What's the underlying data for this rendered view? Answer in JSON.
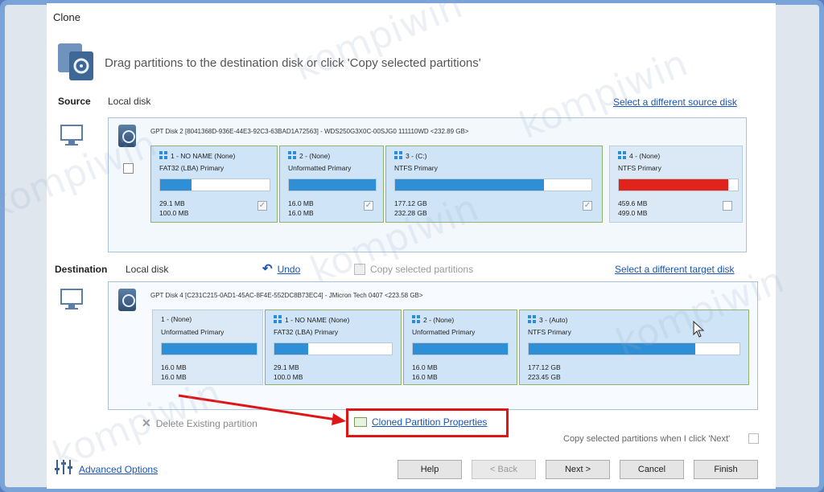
{
  "window": {
    "title": "Clone"
  },
  "hero": {
    "text": "Drag partitions to the destination disk or click 'Copy selected partitions'"
  },
  "source": {
    "label": "Source",
    "disk_label": "Local disk",
    "link": "Select a different source disk",
    "disk_header": "GPT Disk 2 [8041368D-936E-44E3-92C3-63BAD1A72563] - WDS250G3X0C-00SJG0 111110WD  <232.89 GB>",
    "partitions": [
      {
        "name": "1 - NO NAME (None)",
        "fs": "FAT32 (LBA) Primary",
        "used": "29.1 MB",
        "size": "100.0 MB",
        "fill": 0.29,
        "checked": true,
        "win": true
      },
      {
        "name": "2 - (None)",
        "fs": "Unformatted Primary",
        "used": "16.0 MB",
        "size": "16.0 MB",
        "fill": 1.0,
        "checked": true,
        "win": true
      },
      {
        "name": "3 - (C:)",
        "fs": "NTFS Primary",
        "used": "177.12 GB",
        "size": "232.28 GB",
        "fill": 0.76,
        "checked": true,
        "win": true
      },
      {
        "name": "4 - (None)",
        "fs": "NTFS Primary",
        "used": "459.6 MB",
        "size": "499.0 MB",
        "fill": 0.92,
        "checked": false,
        "win": true
      }
    ]
  },
  "destination": {
    "label": "Destination",
    "disk_label": "Local disk",
    "undo": "Undo",
    "copy_selected": "Copy selected partitions",
    "link": "Select a different target disk",
    "disk_header": "GPT Disk 4 [C231C215-0AD1-45AC-8F4E-552DC8B73EC4] - JMicron  Tech            0407  <223.58 GB>",
    "partitions": [
      {
        "name": "1 - (None)",
        "fs": "Unformatted Primary",
        "used": "16.0 MB",
        "size": "16.0 MB",
        "fill": 1.0,
        "win": false
      },
      {
        "name": "1 - NO NAME (None)",
        "fs": "FAT32 (LBA) Primary",
        "used": "29.1 MB",
        "size": "100.0 MB",
        "fill": 0.29,
        "win": true
      },
      {
        "name": "2 - (None)",
        "fs": "Unformatted Primary",
        "used": "16.0 MB",
        "size": "16.0 MB",
        "fill": 1.0,
        "win": true
      },
      {
        "name": "3 - (Auto)",
        "fs": "NTFS Primary",
        "used": "177.12 GB",
        "size": "223.45 GB",
        "fill": 0.79,
        "win": true
      }
    ]
  },
  "actions": {
    "delete_existing": "Delete Existing partition",
    "cloned_props": "Cloned Partition Properties",
    "copy_on_next": "Copy selected partitions when I click 'Next'",
    "advanced": "Advanced Options"
  },
  "buttons": {
    "help": "Help",
    "back": "< Back",
    "next": "Next >",
    "cancel": "Cancel",
    "finish": "Finish"
  },
  "watermark": "kompiwin",
  "colors": {
    "fill_blue": "#2e8fd6",
    "fill_red": "#e0231b",
    "link": "#1a55b5",
    "highlight": "#e01515"
  }
}
